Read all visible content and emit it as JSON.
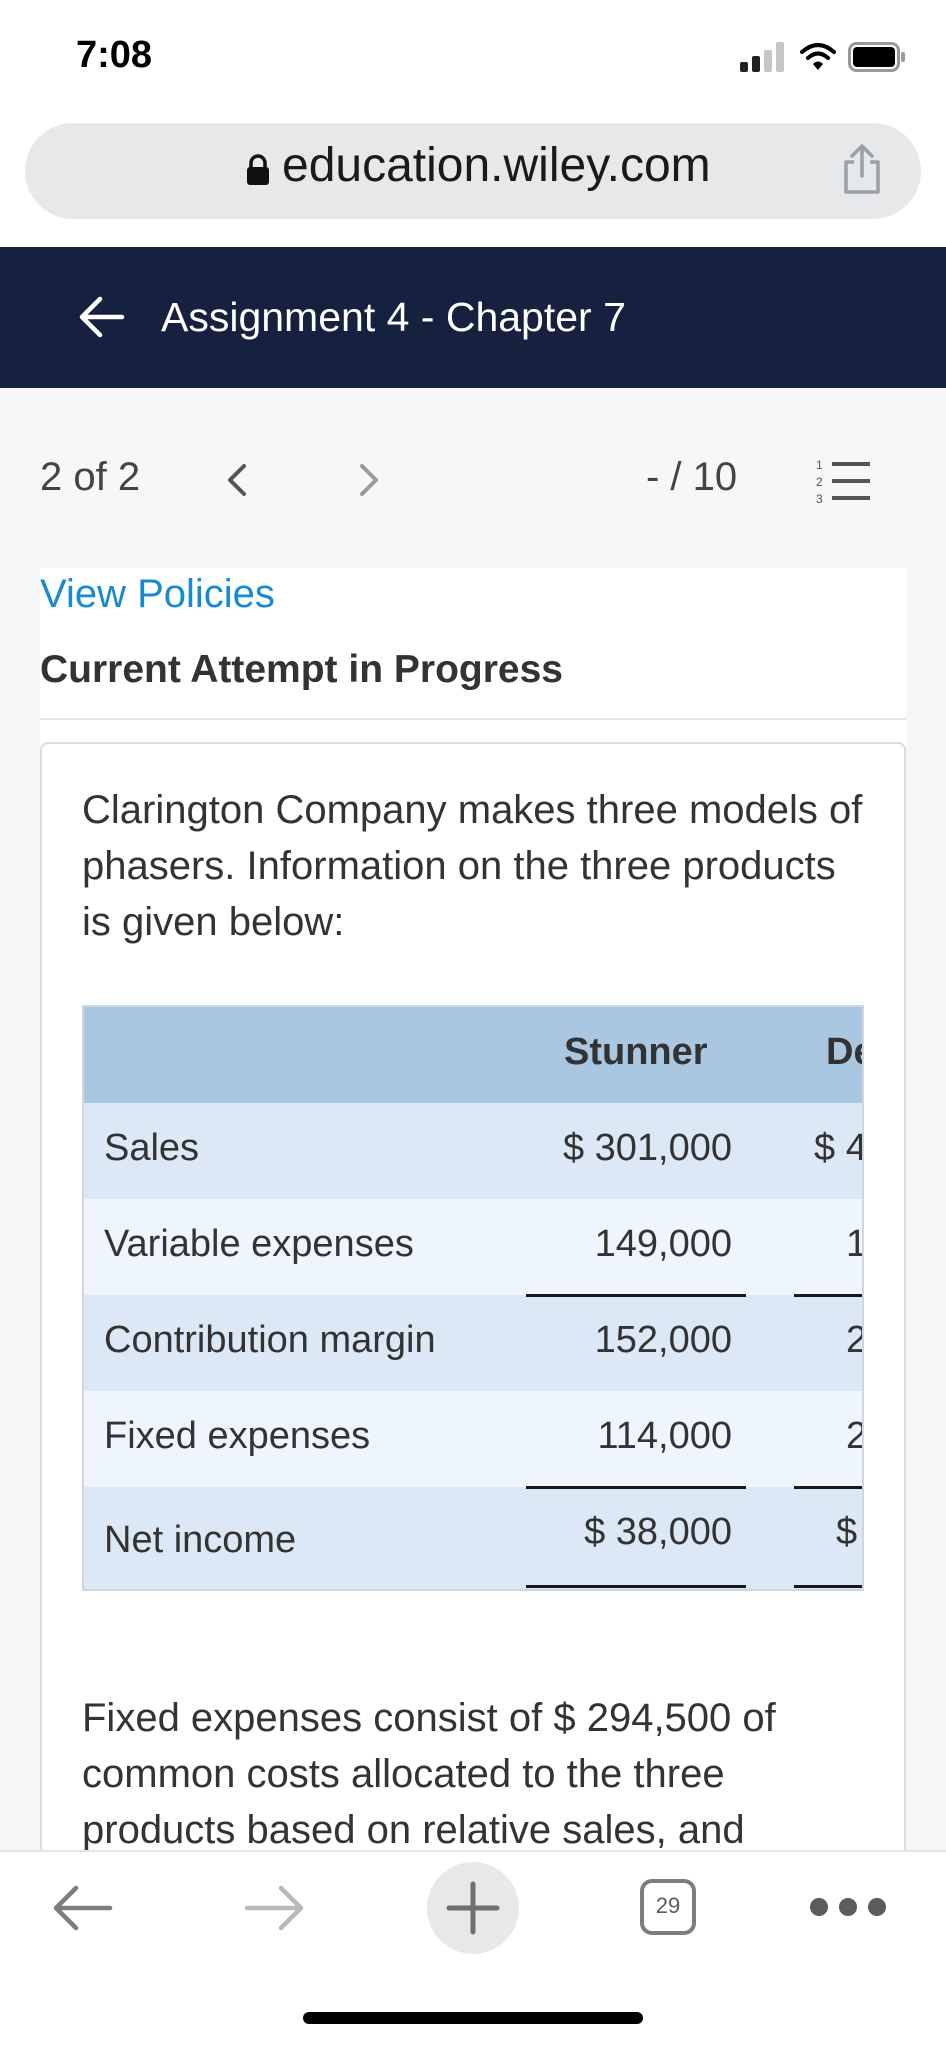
{
  "status_bar": {
    "time": "7:08",
    "icons": [
      "signal-icon",
      "wifi-icon",
      "battery-icon"
    ]
  },
  "browser": {
    "url": "education.wiley.com",
    "icons": [
      "lock-icon",
      "share-icon"
    ]
  },
  "header": {
    "title": "Assignment 4 - Chapter 7",
    "background": "#15213f"
  },
  "nav": {
    "page_count": "2 of 2",
    "score": "- / 10",
    "icons": [
      "chevron-left-icon",
      "chevron-right-icon",
      "numbered-list-icon"
    ]
  },
  "content": {
    "policies_link": "View Policies",
    "attempt_title": "Current Attempt in Progress",
    "question_text": "Clarington Company makes three models of phasers. Information on the three products is given below:",
    "question_text_2": "Fixed expenses consist of $ 294,500 of common costs allocated to the three products based on relative sales, and",
    "link_color": "#1a8ad0"
  },
  "table": {
    "columns": [
      "",
      "Stunner",
      "De"
    ],
    "rows": [
      {
        "label": "Sales",
        "stunner": "$ 301,000",
        "col2": "$ 4"
      },
      {
        "label": "Variable expenses",
        "stunner": "149,000",
        "col2": "1"
      },
      {
        "label": "Contribution margin",
        "stunner": "152,000",
        "col2": "2"
      },
      {
        "label": "Fixed expenses",
        "stunner": "114,000",
        "col2": "2"
      },
      {
        "label": "Net income",
        "stunner": "$ 38,000",
        "col2": "$"
      }
    ],
    "header_color": "#a9c7e1",
    "row_colors": [
      "#dce8f5",
      "#eef5fd"
    ]
  },
  "toolbar": {
    "tabs_count": "29",
    "icons": [
      "back-arrow-icon",
      "forward-arrow-icon",
      "plus-icon",
      "tabs-icon",
      "more-icon"
    ]
  }
}
